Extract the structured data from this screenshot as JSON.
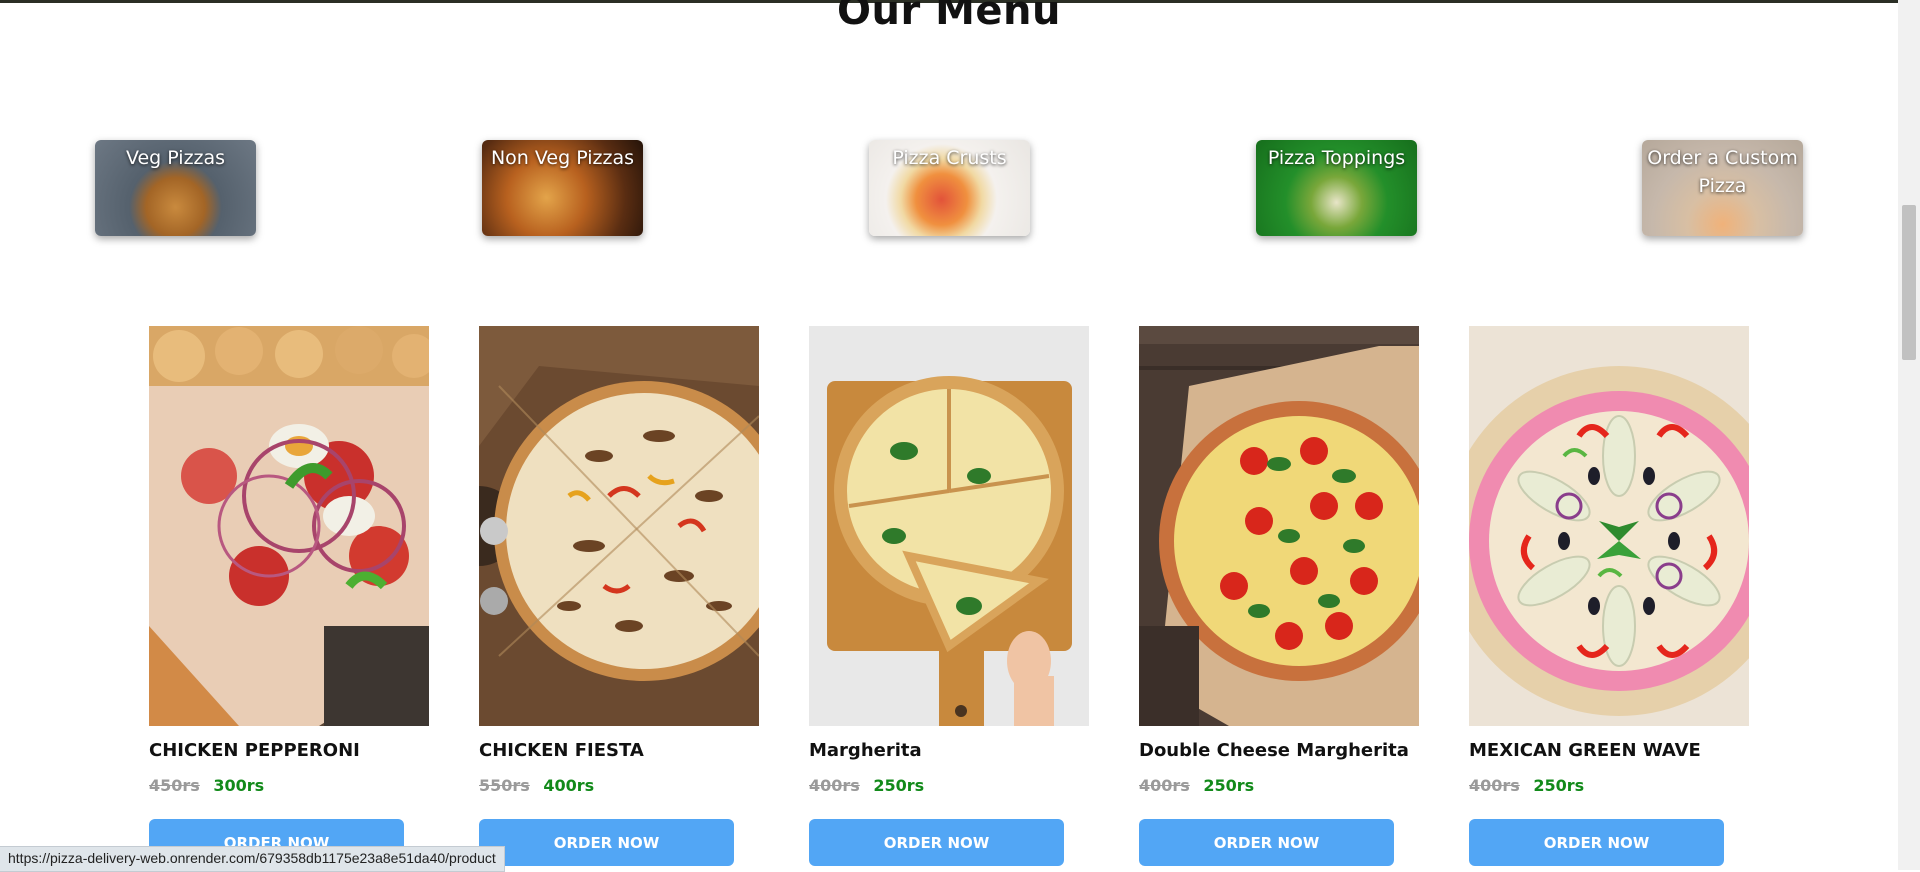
{
  "page": {
    "title": "Our Menu"
  },
  "categories": [
    {
      "label": "Veg Pizzas"
    },
    {
      "label": "Non Veg Pizzas"
    },
    {
      "label": "Pizza Crusts"
    },
    {
      "label": "Pizza Toppings"
    },
    {
      "label": "Order a Custom Pizza"
    }
  ],
  "products": [
    {
      "name": "CHICKEN PEPPERONI",
      "old_price": "450rs",
      "new_price": "300rs",
      "button": "ORDER NOW"
    },
    {
      "name": "CHICKEN FIESTA",
      "old_price": "550rs",
      "new_price": "400rs",
      "button": "ORDER NOW"
    },
    {
      "name": "Margherita",
      "old_price": "400rs",
      "new_price": "250rs",
      "button": "ORDER NOW"
    },
    {
      "name": "Double Cheese Margherita",
      "old_price": "400rs",
      "new_price": "250rs",
      "button": "ORDER NOW"
    },
    {
      "name": "MEXICAN GREEN WAVE",
      "old_price": "400rs",
      "new_price": "250rs",
      "button": "ORDER NOW"
    }
  ],
  "status_bar": {
    "url": "https://pizza-delivery-web.onrender.com/679358db1175e23a8e51da40/product"
  },
  "colors": {
    "button": "#52a6f5",
    "new_price": "#128a1a",
    "old_price": "#9a9a9a"
  }
}
